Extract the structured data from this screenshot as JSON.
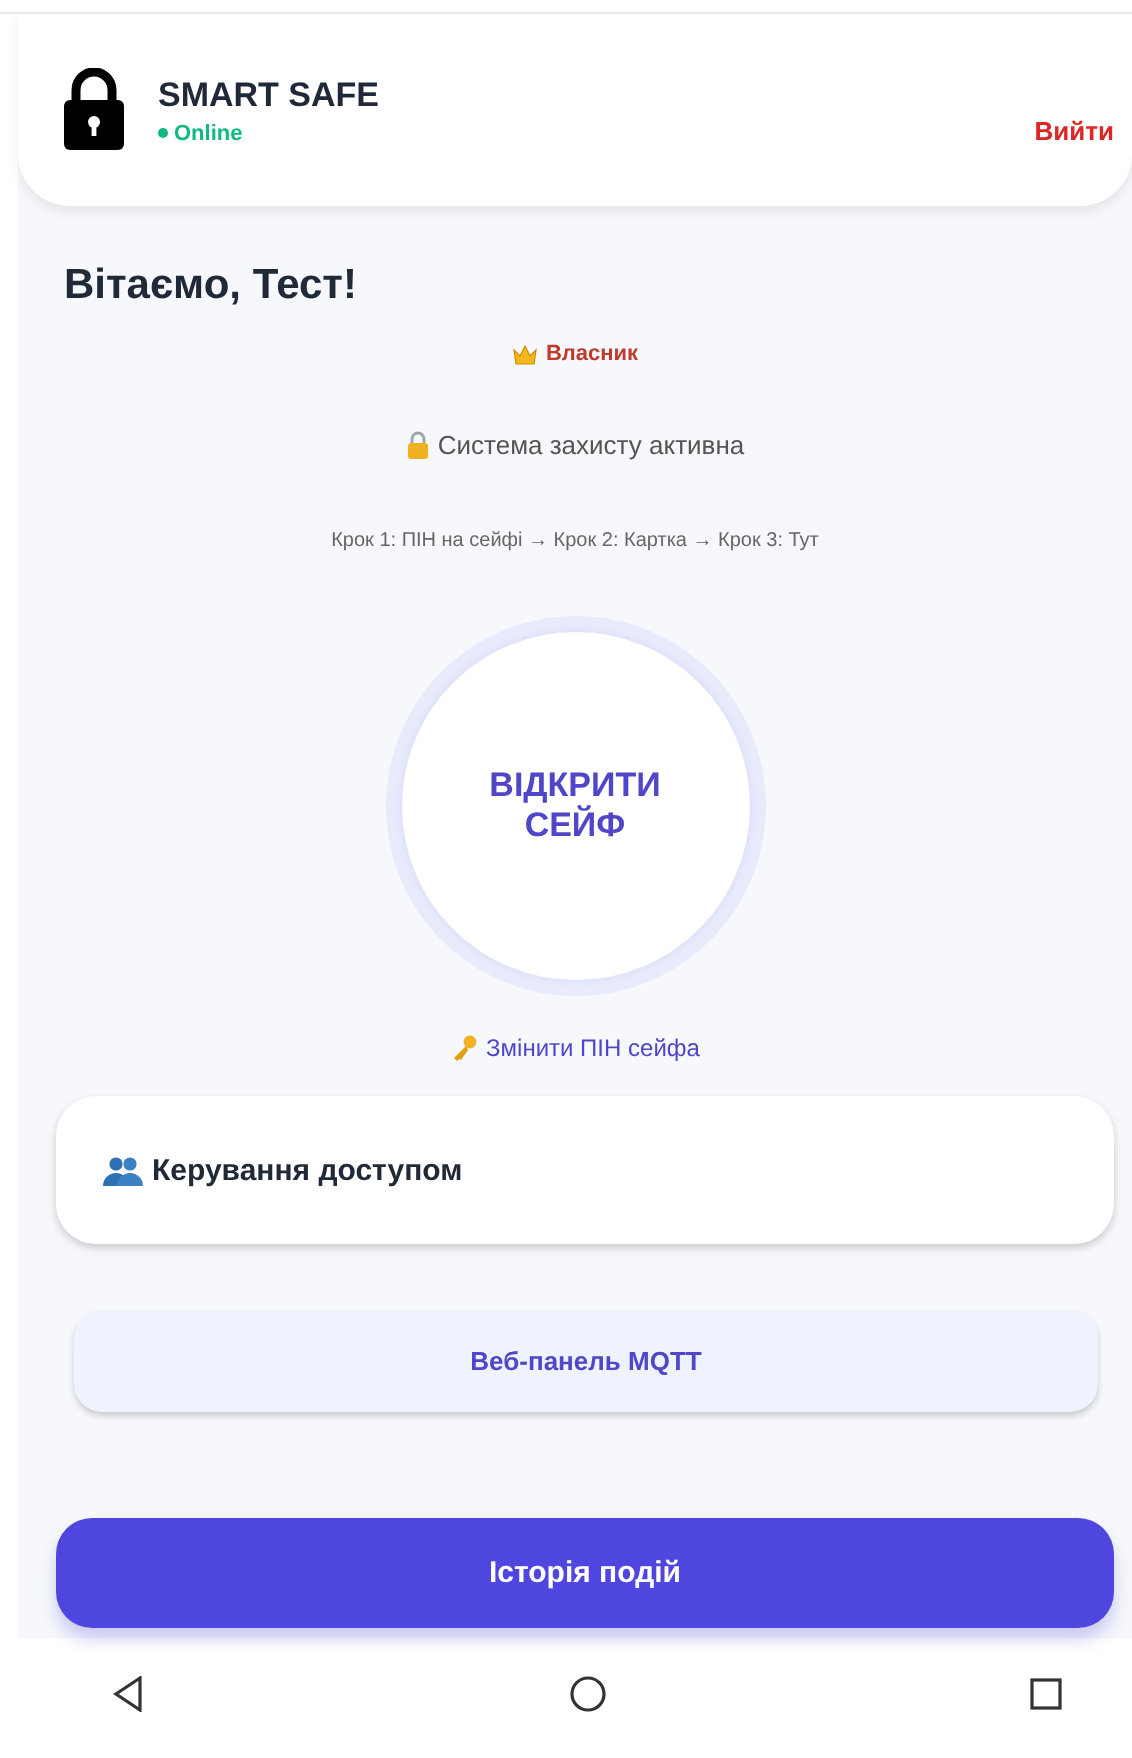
{
  "header": {
    "title": "SMART SAFE",
    "status": {
      "label": "Online",
      "online": true
    },
    "logout": "Вийти"
  },
  "greeting": "Вітаємо, Тест!",
  "role": "Власник",
  "security_status": "Система захисту активна",
  "steps": [
    {
      "label": "Крок 1: ПІН на сейфі"
    },
    {
      "label": "Крок 2: Картка"
    },
    {
      "label": "Крок 3: Тут"
    }
  ],
  "step_separator": "→",
  "open_button": "ВІДКРИТИ СЕЙФ",
  "change_pin_link": "Змінити ПІН сейфа",
  "access_card": {
    "title": "Керування доступом"
  },
  "mqtt_button": "Веб-панель MQTT",
  "history_button": "Історія подій"
}
